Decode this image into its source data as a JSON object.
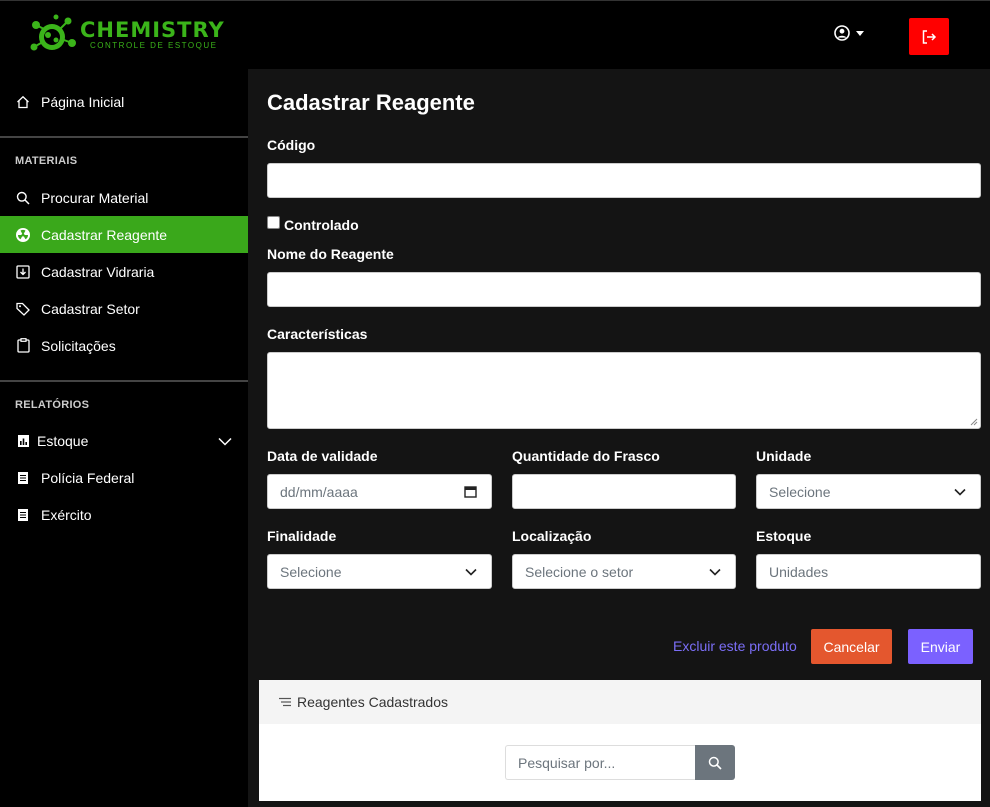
{
  "brand": {
    "title": "CHEMISTRY",
    "subtitle": "CONTROLE DE ESTOQUE"
  },
  "colors": {
    "accent": "#3aa81b",
    "logout": "#ff0000",
    "cancel": "#e4572e",
    "submit": "#7b61ff",
    "link": "#7b6ef6"
  },
  "sidebar": {
    "home": "Página Inicial",
    "section_materials": "MATERIAIS",
    "materials": [
      "Procurar Material",
      "Cadastrar Reagente",
      "Cadastrar Vidraria",
      "Cadastrar Setor",
      "Solicitações"
    ],
    "section_reports": "RELATÓRIOS",
    "reports": [
      "Estoque",
      "Polícia Federal",
      "Exército"
    ]
  },
  "form": {
    "title": "Cadastrar Reagente",
    "codigo_label": "Código",
    "controlado_label": "Controlado",
    "nome_label": "Nome do Reagente",
    "caracteristicas_label": "Características",
    "validade_label": "Data de validade",
    "validade_placeholder": "dd/mm/aaaa",
    "quantidade_label": "Quantidade do Frasco",
    "unidade_label": "Unidade",
    "unidade_value": "Selecione",
    "finalidade_label": "Finalidade",
    "finalidade_value": "Selecione",
    "localizacao_label": "Localização",
    "localizacao_value": "Selecione o setor",
    "estoque_label": "Estoque",
    "estoque_placeholder": "Unidades",
    "delete_link": "Excluir este produto",
    "cancel_button": "Cancelar",
    "submit_button": "Enviar"
  },
  "list": {
    "title": "Reagentes Cadastrados",
    "search_placeholder": "Pesquisar por..."
  }
}
